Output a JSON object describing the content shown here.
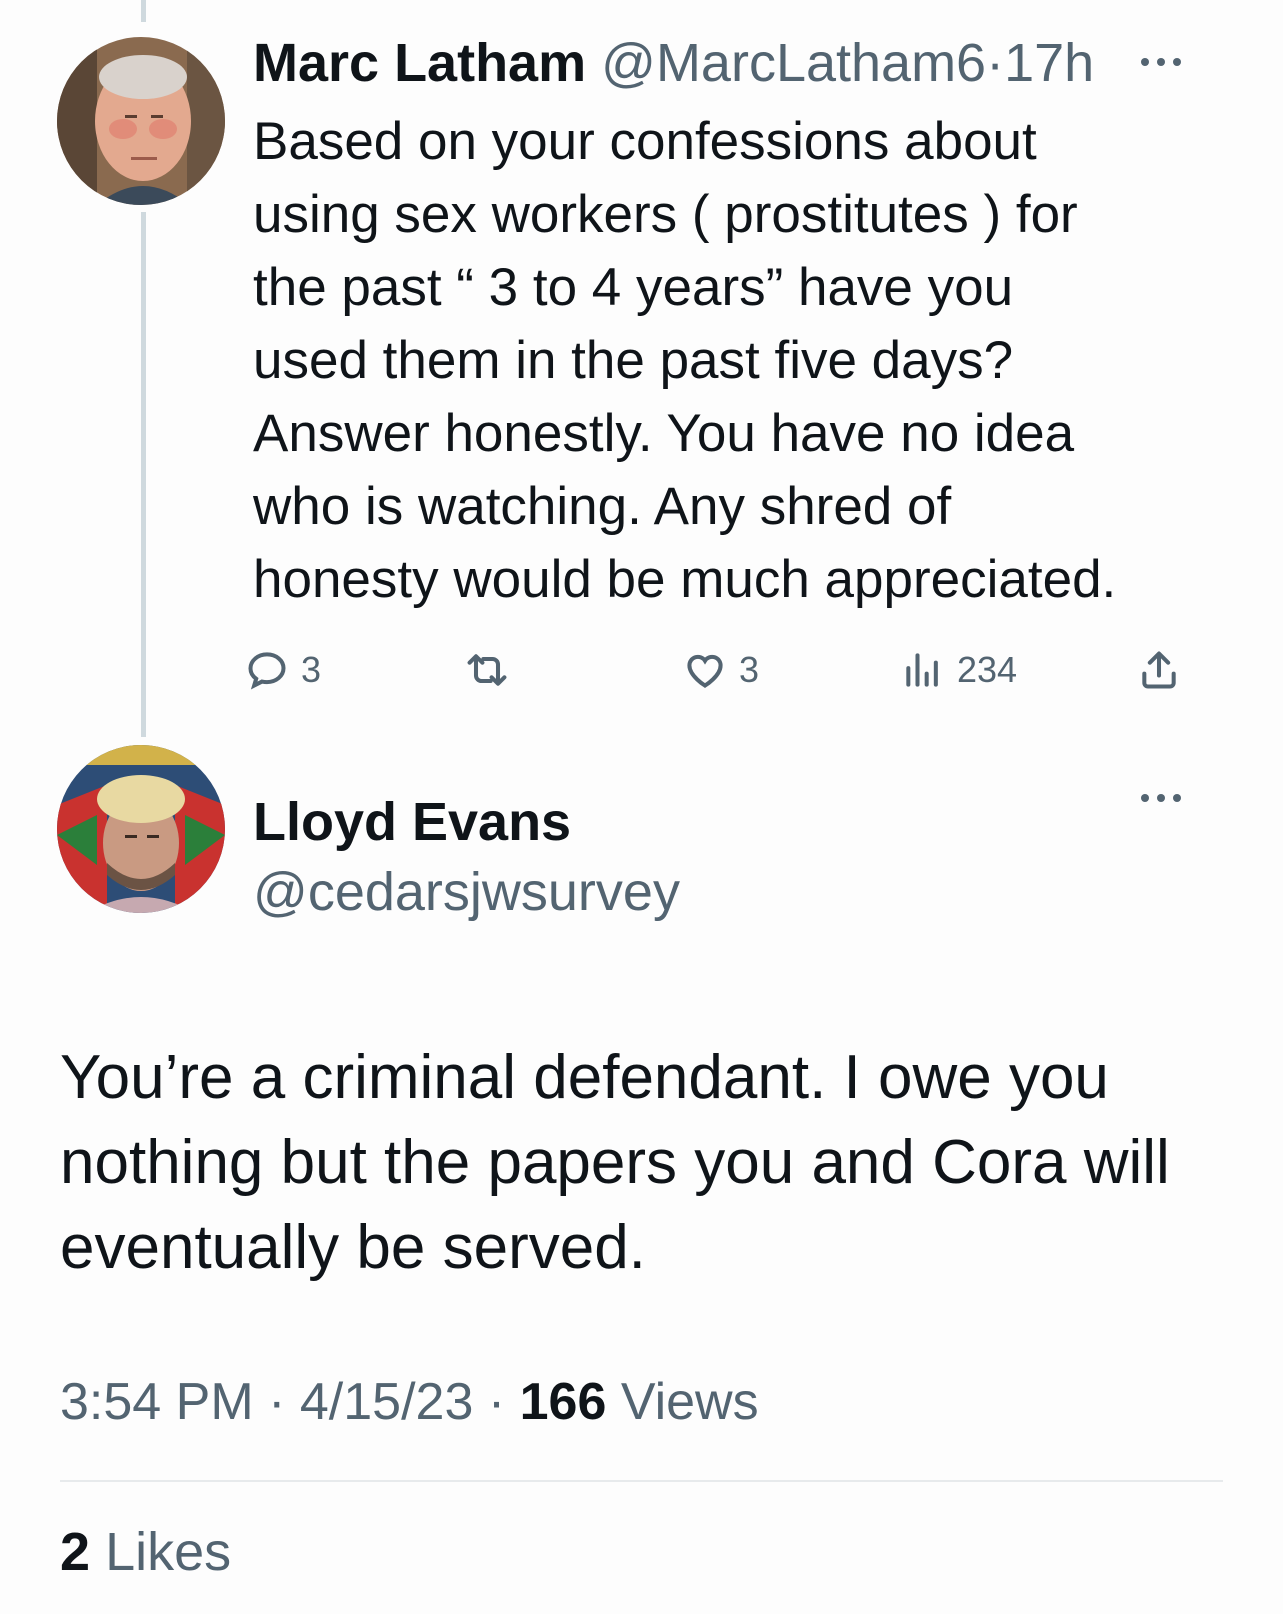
{
  "tweet_reply": {
    "author_name": "Marc Latham",
    "author_handle": "@MarcLatham6",
    "separator": "·",
    "time_ago": "17h",
    "text_lines": [
      "Based on your confessions about",
      "using sex workers ( prostitutes ) for",
      "the past “ 3 to 4 years” have you",
      "used them in the past five days?",
      "Answer honestly.  You have no idea",
      "who is watching.  Any shred of",
      "honesty would be much appreciated."
    ],
    "replies_count": "3",
    "likes_count": "3",
    "views_count": "234"
  },
  "tweet_main": {
    "author_name": "Lloyd Evans",
    "author_handle": "@cedarsjwsurvey",
    "text_lines": [
      "You’re a criminal defendant. I owe you",
      "nothing but the papers you and Cora will",
      "eventually be served."
    ],
    "time": "3:54 PM",
    "separator": "·",
    "date": "4/15/23",
    "views_count": "166",
    "views_label": "Views",
    "likes_count": "2",
    "likes_label": "Likes"
  },
  "icons": [
    "more-icon",
    "reply-icon",
    "retweet-icon",
    "like-icon",
    "views-icon",
    "share-icon"
  ],
  "colors": {
    "text": "#0f1419",
    "muted": "#536471",
    "thread_line": "#cfd9de"
  }
}
